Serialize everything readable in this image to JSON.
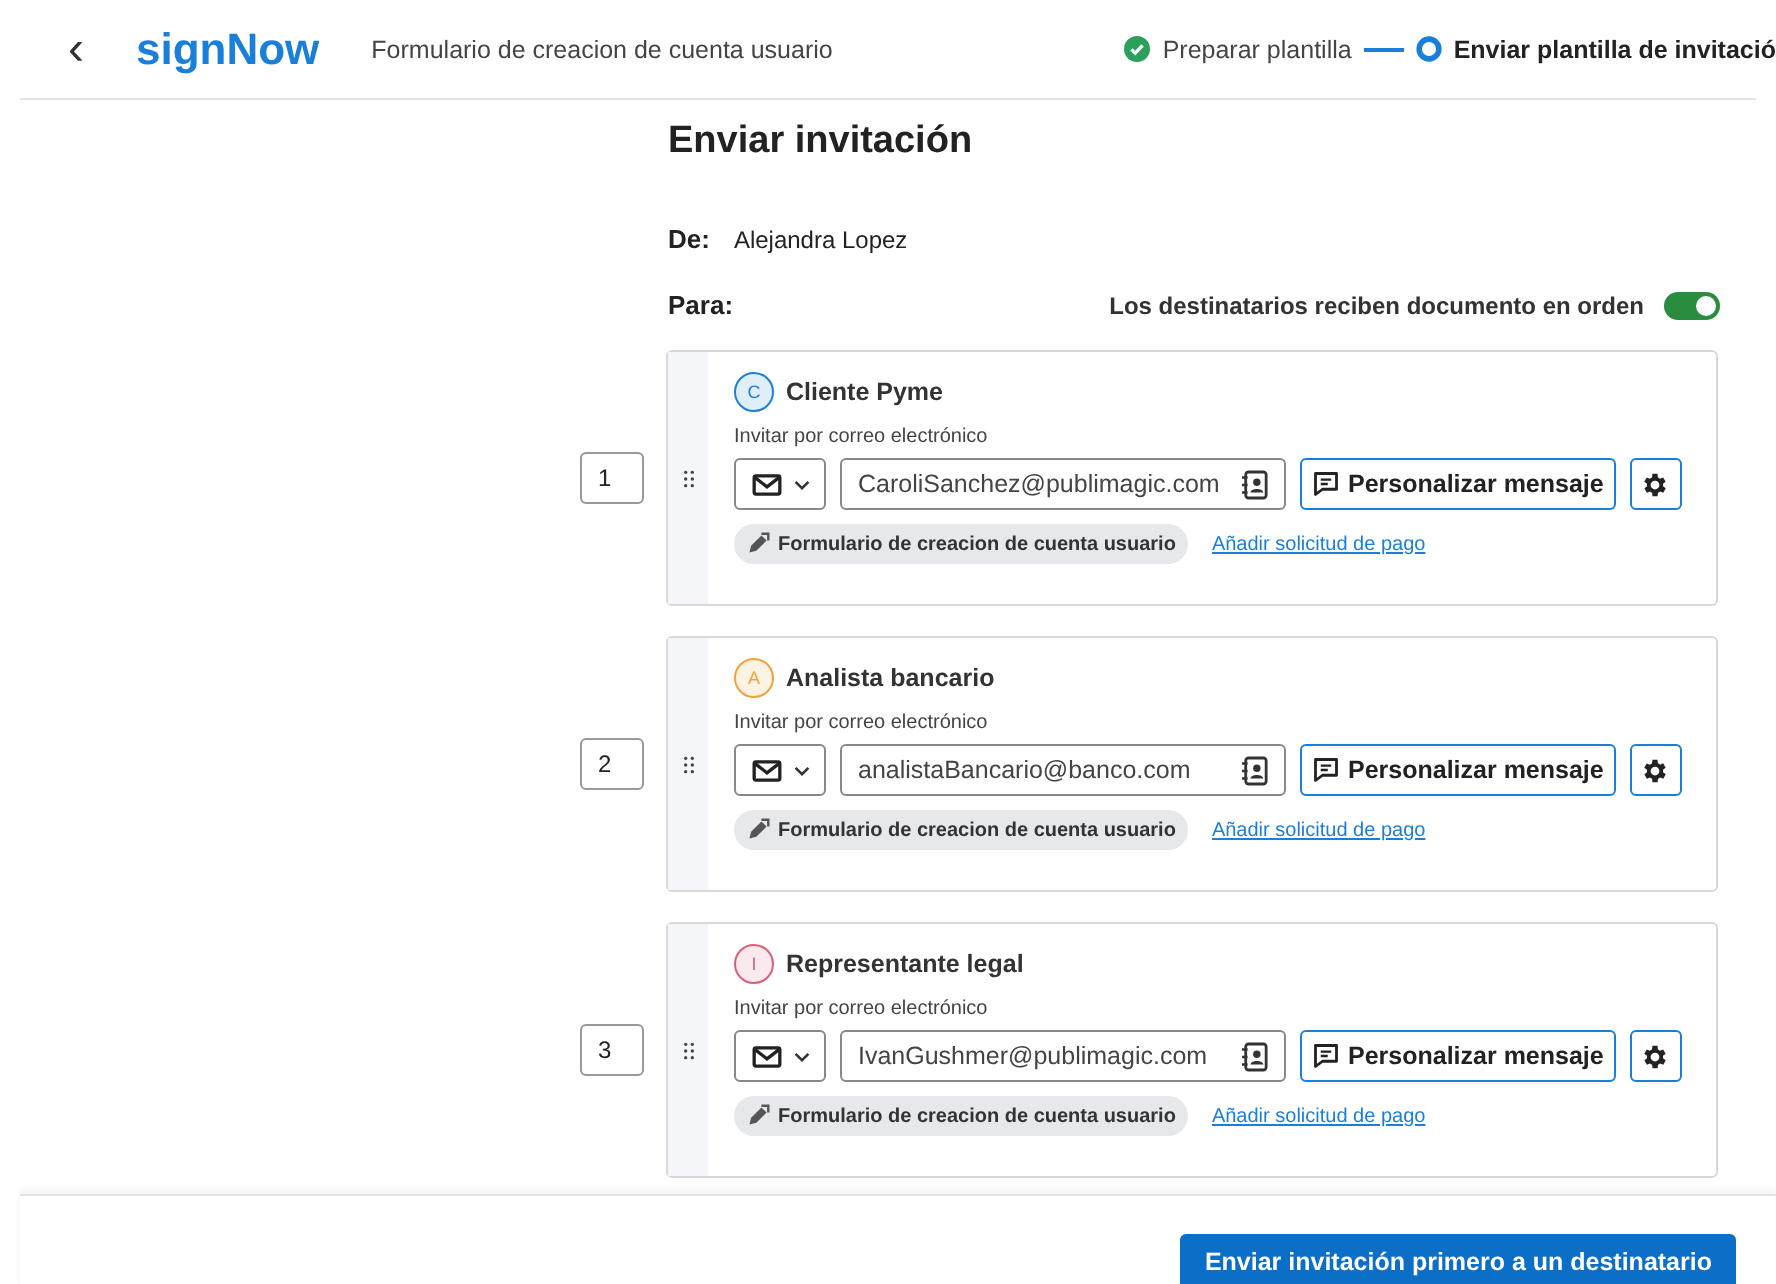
{
  "header": {
    "back": "‹",
    "logo": "signNow",
    "document_title": "Formulario de creacion de cuenta usuario",
    "steps": [
      {
        "label": "Preparar plantilla",
        "done": true
      },
      {
        "label": "Enviar plantilla de invitació",
        "done": false
      }
    ]
  },
  "title": "Enviar invitación",
  "from": {
    "label": "De:",
    "value": "Alejandra Lopez"
  },
  "to": {
    "label": "Para:",
    "order_label": "Los destinatarios reciben documento en orden",
    "order_on": true
  },
  "recipients": [
    {
      "order": "1",
      "initial": "C",
      "role": "Cliente Pyme",
      "color": "#1a7fd8",
      "invite_label": "Invitar por correo electrónico",
      "email": "CaroliSanchez@publimagic.com",
      "message_button": "Personalizar mensaje",
      "document": "Formulario de creacion de cuenta usuario",
      "payment_link": "Añadir solicitud de pago"
    },
    {
      "order": "2",
      "initial": "A",
      "role": "Analista bancario",
      "color": "#f0a33a",
      "invite_label": "Invitar por correo electrónico",
      "email": "analistaBancario@banco.com",
      "message_button": "Personalizar mensaje",
      "document": "Formulario de creacion de cuenta usuario",
      "payment_link": "Añadir solicitud de pago"
    },
    {
      "order": "3",
      "initial": "I",
      "role": "Representante legal",
      "color": "#d9607a",
      "invite_label": "Invitar por correo electrónico",
      "email": "IvanGushmer@publimagic.com",
      "message_button": "Personalizar mensaje",
      "document": "Formulario de creacion de cuenta usuario",
      "payment_link": "Añadir solicitud de pago"
    }
  ],
  "send_button": "Enviar invitación primero a un destinatario"
}
